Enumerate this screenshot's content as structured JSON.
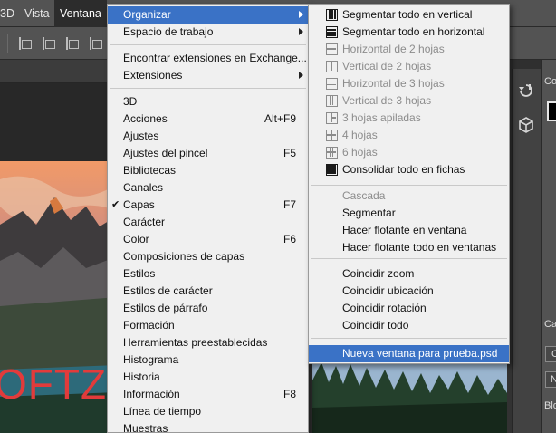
{
  "menubar": {
    "items": [
      {
        "label": "3D"
      },
      {
        "label": "Vista"
      },
      {
        "label": "Ventana"
      }
    ]
  },
  "main_menu": {
    "organizar": "Organizar",
    "espacio_trabajo": "Espacio de trabajo",
    "encontrar_exchange": "Encontrar extensiones en Exchange...",
    "extensiones": "Extensiones",
    "panels": [
      {
        "label": "3D",
        "shortcut": "",
        "checked": false
      },
      {
        "label": "Acciones",
        "shortcut": "Alt+F9",
        "checked": false
      },
      {
        "label": "Ajustes",
        "shortcut": "",
        "checked": false
      },
      {
        "label": "Ajustes del pincel",
        "shortcut": "F5",
        "checked": false
      },
      {
        "label": "Bibliotecas",
        "shortcut": "",
        "checked": false
      },
      {
        "label": "Canales",
        "shortcut": "",
        "checked": false
      },
      {
        "label": "Capas",
        "shortcut": "F7",
        "checked": true
      },
      {
        "label": "Carácter",
        "shortcut": "",
        "checked": false
      },
      {
        "label": "Color",
        "shortcut": "F6",
        "checked": false
      },
      {
        "label": "Composiciones de capas",
        "shortcut": "",
        "checked": false
      },
      {
        "label": "Estilos",
        "shortcut": "",
        "checked": false
      },
      {
        "label": "Estilos de carácter",
        "shortcut": "",
        "checked": false
      },
      {
        "label": "Estilos de párrafo",
        "shortcut": "",
        "checked": false
      },
      {
        "label": "Formación",
        "shortcut": "",
        "checked": false
      },
      {
        "label": "Herramientas preestablecidas",
        "shortcut": "",
        "checked": false
      },
      {
        "label": "Histograma",
        "shortcut": "",
        "checked": false
      },
      {
        "label": "Historia",
        "shortcut": "",
        "checked": false
      },
      {
        "label": "Información",
        "shortcut": "F8",
        "checked": false
      },
      {
        "label": "Línea de tiempo",
        "shortcut": "",
        "checked": false
      },
      {
        "label": "Muestras",
        "shortcut": "",
        "checked": false
      }
    ],
    "checkmark": "✔"
  },
  "submenu": {
    "layout_items": [
      {
        "label": "Segmentar todo en vertical",
        "icon": "tile-vertical-icon",
        "disabled": false
      },
      {
        "label": "Segmentar todo en horizontal",
        "icon": "tile-horizontal-icon",
        "disabled": false
      },
      {
        "label": "Horizontal de 2 hojas",
        "icon": "two-up-horizontal-icon",
        "disabled": true
      },
      {
        "label": "Vertical de 2 hojas",
        "icon": "two-up-vertical-icon",
        "disabled": true
      },
      {
        "label": "Horizontal de 3 hojas",
        "icon": "three-up-horizontal-icon",
        "disabled": true
      },
      {
        "label": "Vertical de 3 hojas",
        "icon": "three-up-vertical-icon",
        "disabled": true
      },
      {
        "label": "3 hojas apiladas",
        "icon": "three-up-stacked-icon",
        "disabled": true
      },
      {
        "label": "4 hojas",
        "icon": "four-up-icon",
        "disabled": true
      },
      {
        "label": "6 hojas",
        "icon": "six-up-icon",
        "disabled": true
      },
      {
        "label": "Consolidar todo en fichas",
        "icon": "consolidate-tabs-icon",
        "disabled": false
      }
    ],
    "window_items": [
      {
        "label": "Cascada",
        "disabled": true
      },
      {
        "label": "Segmentar",
        "disabled": false
      },
      {
        "label": "Hacer flotante en ventana",
        "disabled": false
      },
      {
        "label": "Hacer flotante todo en ventanas",
        "disabled": false
      }
    ],
    "match_items": [
      {
        "label": "Coincidir zoom"
      },
      {
        "label": "Coincidir ubicación"
      },
      {
        "label": "Coincidir rotación"
      },
      {
        "label": "Coincidir todo"
      }
    ],
    "new_window": "Nueva ventana para prueba.psd"
  },
  "canvas": {
    "watermark": "OFTZO"
  },
  "panel": {
    "label_co": "Co",
    "label_ca": "Ca",
    "label_c": "C",
    "label_n": "N",
    "label_blo": "Blo"
  },
  "colors": {
    "menubar": "#535353",
    "menu_bg": "#f0f0f0",
    "highlight": "#3a72c6",
    "disabled_text": "#8c8c8c",
    "watermark": "#e23b3b"
  }
}
